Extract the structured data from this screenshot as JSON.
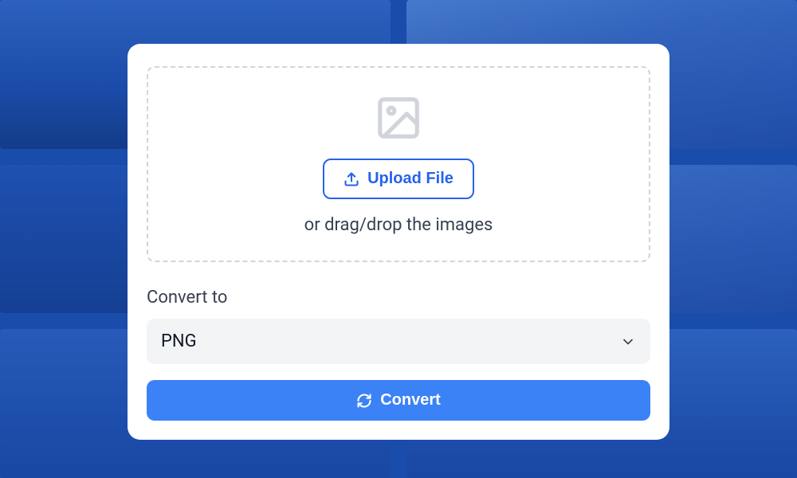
{
  "dropzone": {
    "upload_button_label": "Upload File",
    "drag_text": "or drag/drop the images"
  },
  "convert": {
    "label": "Convert to",
    "selected_format": "PNG",
    "button_label": "Convert"
  }
}
